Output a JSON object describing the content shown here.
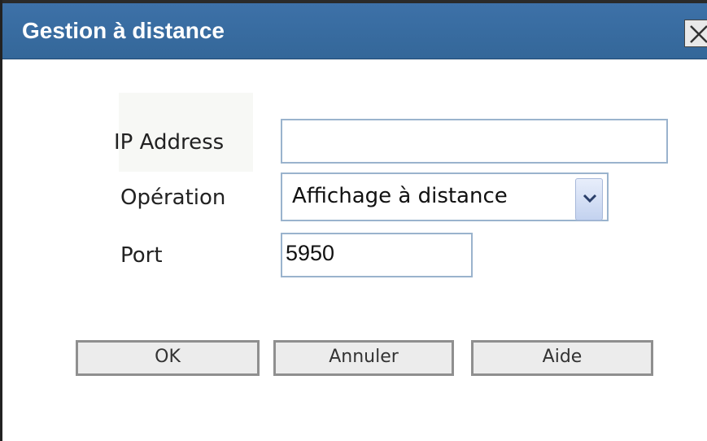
{
  "dialog": {
    "title": "Gestion à distance",
    "close_icon": "close-icon"
  },
  "form": {
    "ip_label": "IP Address",
    "ip_value": "",
    "operation_label": "Opération",
    "operation_selected": "Affichage à distance",
    "operation_arrow_icon": "chevron-down-icon",
    "port_label": "Port",
    "port_value": "5950"
  },
  "buttons": {
    "ok": "OK",
    "cancel": "Annuler",
    "help": "Aide"
  },
  "colors": {
    "titlebar": "#3a6ea5",
    "field_border": "#9ab3cd",
    "button_face": "#ececec"
  }
}
